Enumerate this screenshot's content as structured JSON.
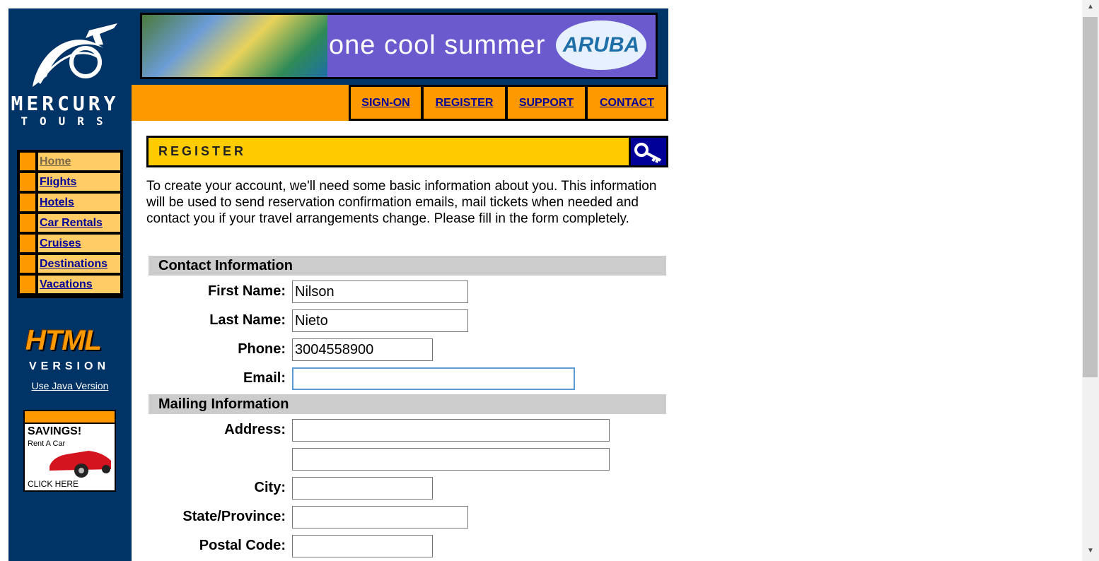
{
  "brand": {
    "name_line1": "MERCURY",
    "name_line2": "TOURS"
  },
  "sidebar": {
    "nav": [
      {
        "label": "Home"
      },
      {
        "label": "Flights"
      },
      {
        "label": "Hotels"
      },
      {
        "label": "Car Rentals"
      },
      {
        "label": "Cruises"
      },
      {
        "label": "Destinations"
      },
      {
        "label": "Vacations"
      }
    ],
    "html_version": {
      "big": "HTML",
      "small": "VERSION"
    },
    "java_link": "Use Java Version",
    "ad": {
      "line1": "SAVINGS!",
      "line2": "Rent A Car",
      "line3": "CLICK HERE"
    }
  },
  "banner": {
    "text": "one cool summer",
    "badge": "ARUBA"
  },
  "topnav": {
    "signon": "SIGN-ON",
    "register": "REGISTER",
    "support": "SUPPORT",
    "contact": "CONTACT"
  },
  "page": {
    "header": "REGISTER",
    "intro": "To create your account, we'll need some basic information about you. This information will be used to send reservation confirmation emails, mail tickets when needed and contact you if your travel arrangements change. Please fill in the form completely."
  },
  "form": {
    "contact_section": "Contact Information",
    "first_name_label": "First Name:",
    "first_name_value": "Nilson",
    "last_name_label": "Last Name:",
    "last_name_value": "Nieto",
    "phone_label": "Phone:",
    "phone_value": "3004558900",
    "email_label": "Email:",
    "email_value": "",
    "mailing_section": "Mailing Information",
    "address_label": "Address:",
    "address1_value": "",
    "address2_value": "",
    "city_label": "City:",
    "city_value": "",
    "state_label": "State/Province:",
    "state_value": "",
    "postal_label": "Postal Code:",
    "postal_value": ""
  },
  "colors": {
    "sidebar_bg": "#003366",
    "accent_orange": "#ff9900",
    "nav_cell": "#ffcc66",
    "header_yellow": "#ffcc00",
    "link_blue": "#000099",
    "section_grey": "#cccccc"
  }
}
